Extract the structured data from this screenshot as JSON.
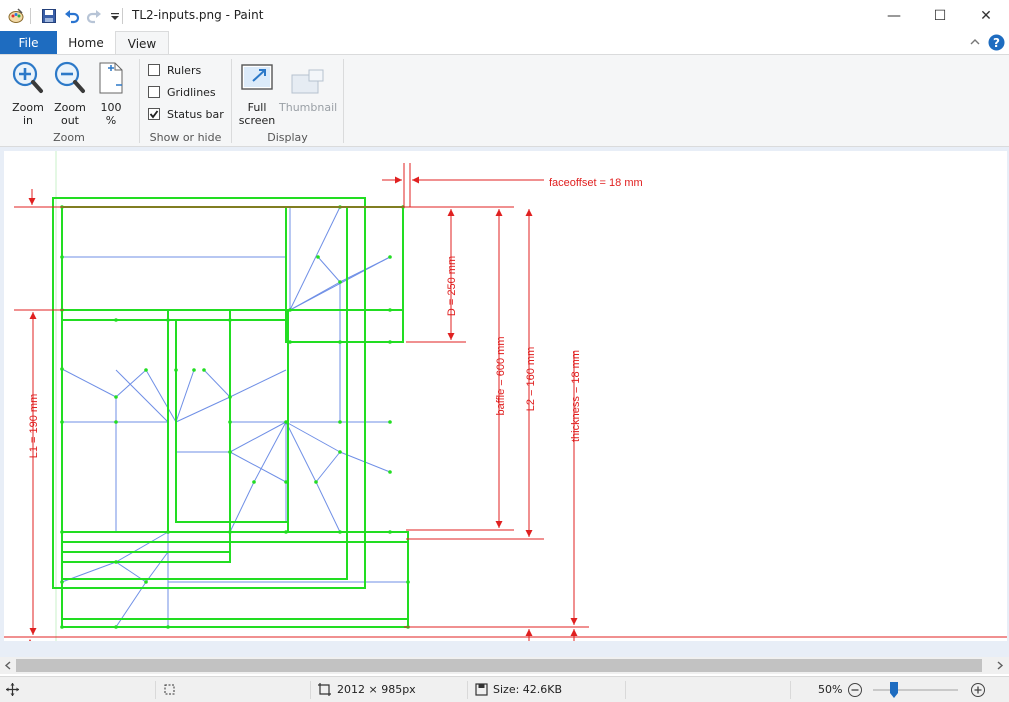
{
  "window": {
    "title": "TL2-inputs.png - Paint",
    "minimize_glyph": "—",
    "maximize_glyph": "☐",
    "close_glyph": "✕"
  },
  "tabs": {
    "file": "File",
    "home": "Home",
    "view": "View"
  },
  "ribbon": {
    "zoom_group": {
      "label": "Zoom",
      "zoom_in_line1": "Zoom",
      "zoom_in_line2": "in",
      "zoom_out_line1": "Zoom",
      "zoom_out_line2": "out",
      "hundred_line1": "100",
      "hundred_line2": "%"
    },
    "show_hide_group": {
      "label": "Show or hide",
      "rulers": "Rulers",
      "rulers_checked": false,
      "gridlines": "Gridlines",
      "gridlines_checked": false,
      "status_bar": "Status bar",
      "status_bar_checked": true
    },
    "display_group": {
      "label": "Display",
      "full_screen_line1": "Full",
      "full_screen_line2": "screen",
      "thumbnail": "Thumbnail"
    }
  },
  "drawing": {
    "faceoffset": "faceoffset = 18 mm",
    "d": "D = 250 mm",
    "baffle": "baffle = 600 mm",
    "l2": "L2 = 160 mm",
    "thickness": "thickness = 18 mm",
    "l1": "L1 = 190 mm",
    "colors": {
      "dimension": "#e02020",
      "outline": "#22dd22",
      "mesh": "#6f8fe6"
    }
  },
  "statusbar": {
    "dimensions": "2012 × 985px",
    "size": "Size: 42.6KB",
    "zoom": "50%",
    "zoom_level": 0.5
  },
  "icons": {
    "app": "paint-app-icon",
    "save": "save-icon",
    "undo": "undo-icon",
    "redo": "redo-icon",
    "help": "help-icon",
    "collapse": "chevron-up-icon"
  }
}
